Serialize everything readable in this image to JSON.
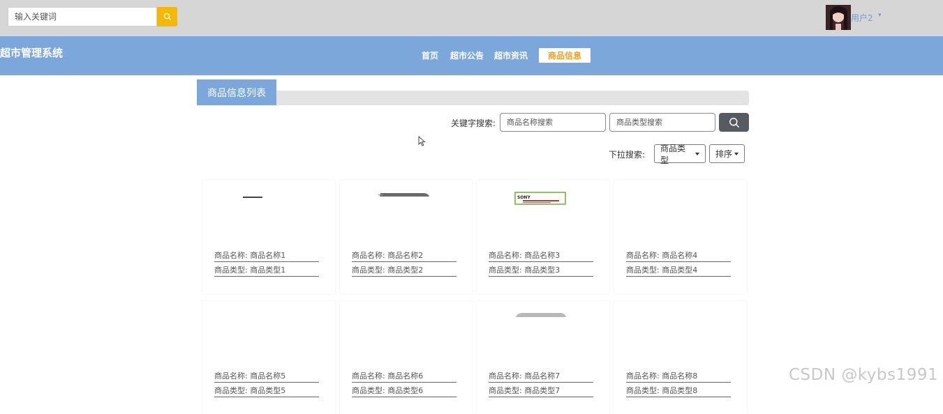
{
  "header": {
    "search_placeholder": "输入关键词",
    "username": "用户2",
    "caret": "▾"
  },
  "nav": {
    "brand": "超市管理系统",
    "items": [
      "首页",
      "超市公告",
      "超市资讯"
    ],
    "active": "商品信息"
  },
  "section": {
    "title": "商品信息列表"
  },
  "filters": {
    "keyword_label": "关键字搜索:",
    "name_placeholder": "商品名称搜索",
    "type_placeholder": "商品类型搜索",
    "dropdown_label": "下拉搜索:",
    "type_dropdown": "商品类型",
    "sort_dropdown": "排序"
  },
  "products": [
    {
      "name_label": "商品名称:",
      "name": "商品名称1",
      "type_label": "商品类型:",
      "type": "商品类型1"
    },
    {
      "name_label": "商品名称:",
      "name": "商品名称2",
      "type_label": "商品类型:",
      "type": "商品类型2"
    },
    {
      "name_label": "商品名称:",
      "name": "商品名称3",
      "type_label": "商品类型:",
      "type": "商品类型3"
    },
    {
      "name_label": "商品名称:",
      "name": "商品名称4",
      "type_label": "商品类型:",
      "type": "商品类型4"
    },
    {
      "name_label": "商品名称:",
      "name": "商品名称5",
      "type_label": "商品类型:",
      "type": "商品类型5"
    },
    {
      "name_label": "商品名称:",
      "name": "商品名称6",
      "type_label": "商品类型:",
      "type": "商品类型6"
    },
    {
      "name_label": "商品名称:",
      "name": "商品名称7",
      "type_label": "商品类型:",
      "type": "商品类型7"
    },
    {
      "name_label": "商品名称:",
      "name": "商品名称8",
      "type_label": "商品类型:",
      "type": "商品类型8"
    }
  ],
  "thumb_brand": "SONY",
  "watermark": "CSDN @kybs1991",
  "colors": {
    "nav_bg": "#7ca7db",
    "top_bg": "#d6d6d6",
    "search_btn": "#f5b800",
    "active_text": "#f0a020",
    "username": "#6f9fd8"
  }
}
